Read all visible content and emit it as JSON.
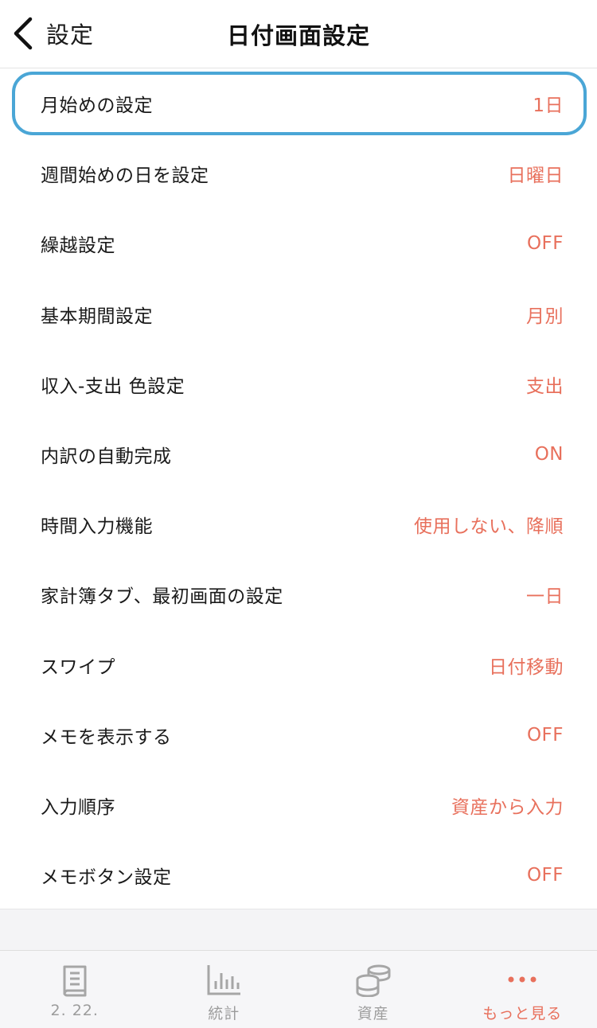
{
  "header": {
    "back_label": "設定",
    "title": "日付画面設定"
  },
  "settings": [
    {
      "label": "月始めの設定",
      "value": "1日"
    },
    {
      "label": "週間始めの日を設定",
      "value": "日曜日"
    },
    {
      "label": "繰越設定",
      "value": "OFF"
    },
    {
      "label": "基本期間設定",
      "value": "月別"
    },
    {
      "label": "収入-支出 色設定",
      "value": "支出"
    },
    {
      "label": "内訳の自動完成",
      "value": "ON"
    },
    {
      "label": "時間入力機能",
      "value": "使用しない、降順"
    },
    {
      "label": "家計簿タブ、最初画面の設定",
      "value": "一日"
    },
    {
      "label": "スワイプ",
      "value": "日付移動"
    },
    {
      "label": "メモを表示する",
      "value": "OFF"
    },
    {
      "label": "入力順序",
      "value": "資産から入力"
    },
    {
      "label": "メモボタン設定",
      "value": "OFF"
    }
  ],
  "tabs": [
    {
      "label": "2. 22.",
      "icon": "book-icon"
    },
    {
      "label": "統計",
      "icon": "bar-chart-icon"
    },
    {
      "label": "資産",
      "icon": "coins-icon"
    },
    {
      "label": "もっと見る",
      "icon": "more-dots-icon"
    }
  ],
  "colors": {
    "accent": "#e8705c",
    "highlight": "#4aa6d6",
    "inactive": "#9c9c9c"
  }
}
